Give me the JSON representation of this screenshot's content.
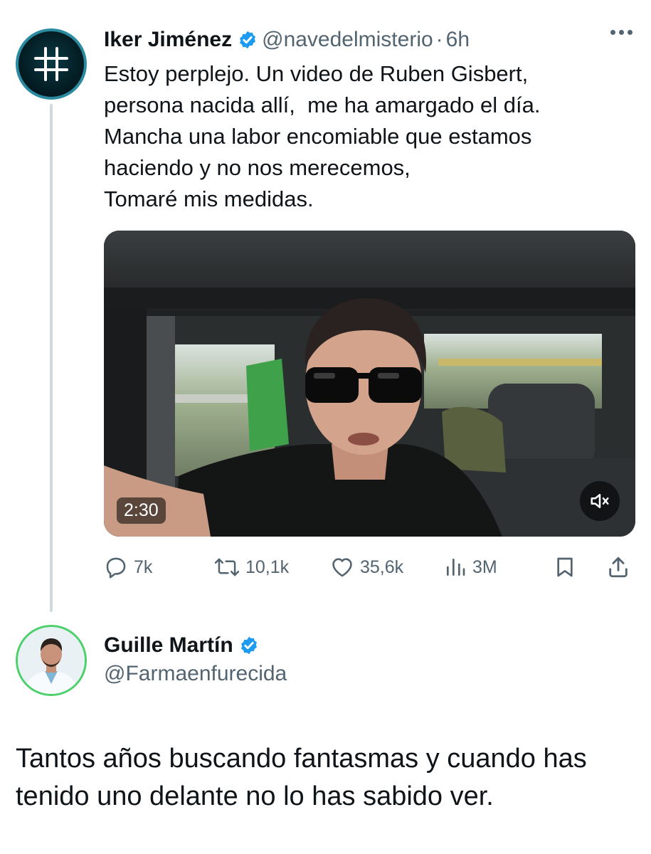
{
  "colors": {
    "verified": "#1d9bf0",
    "muted_text": "#536471",
    "text": "#0f1419",
    "avatar_ring": "#4cd06c"
  },
  "tweet": {
    "author_name": "Iker Jiménez",
    "handle": "@navedelmisterio",
    "separator": "·",
    "time": "6h",
    "text_lines": [
      "Estoy perplejo. Un video de Ruben Gisbert,",
      "persona nacida allí,  me ha amargado el día.",
      "Mancha una labor encomiable que estamos",
      "haciendo y no nos merecemos,",
      "Tomaré mis medidas."
    ],
    "video": {
      "duration": "2:30",
      "muted": true
    },
    "stats": {
      "replies": "7k",
      "reposts": "10,1k",
      "likes": "35,6k",
      "views": "3M"
    },
    "icons": [
      "hashtag-icon",
      "verified-icon",
      "more-icon",
      "reply-icon",
      "repost-icon",
      "like-icon",
      "views-icon",
      "bookmark-icon",
      "share-icon",
      "mute-icon"
    ]
  },
  "reply": {
    "author_name": "Guille Martín",
    "handle": "@Farmaenfurecida",
    "text_lines": [
      "Tantos años buscando fantasmas y cuando has",
      "tenido uno delante no lo has sabido ver."
    ]
  }
}
